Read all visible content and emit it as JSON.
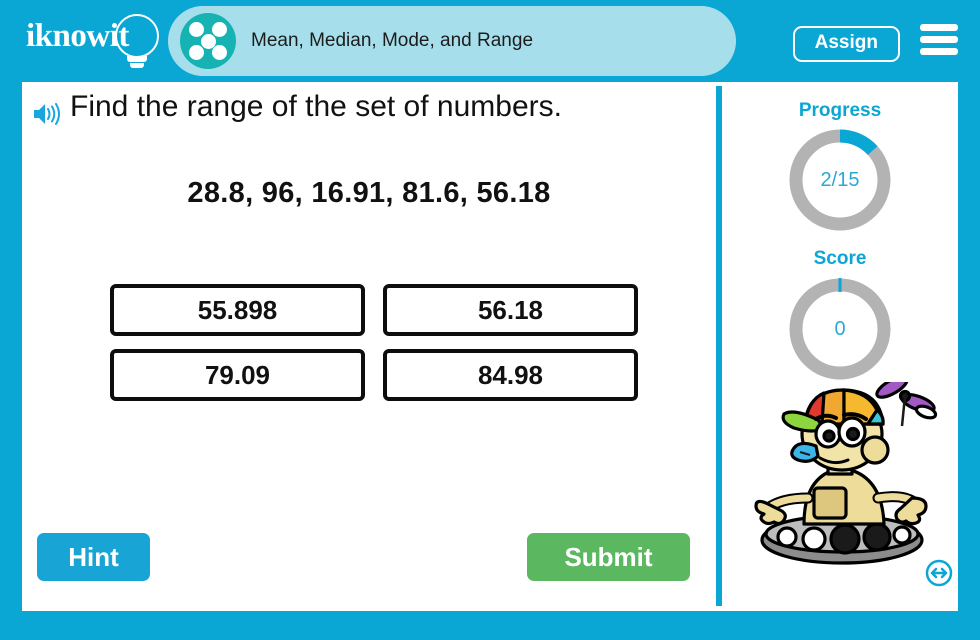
{
  "header": {
    "logo_text": "iknowit",
    "logo_icon": "lightbulb-icon",
    "topic_icon": "five-dots-icon",
    "title": "Mean, Median, Mode, and Range",
    "assign_label": "Assign",
    "menu_icon": "hamburger-menu-icon"
  },
  "question": {
    "speaker_icon": "speaker-audio-icon",
    "prompt": "Find the range of the set of numbers.",
    "numbers": "28.8, 96, 16.91, 81.6, 56.18"
  },
  "answers": [
    {
      "label": "55.898"
    },
    {
      "label": "56.18"
    },
    {
      "label": "79.09"
    },
    {
      "label": "84.98"
    }
  ],
  "actions": {
    "hint_label": "Hint",
    "submit_label": "Submit"
  },
  "sidebar": {
    "progress": {
      "label": "Progress",
      "value": "2/15",
      "current": 2,
      "total": 15,
      "percent": 13.3
    },
    "score": {
      "label": "Score",
      "value": "0",
      "percent": 0
    },
    "mascot_icon": "robot-mascot-icon",
    "resize_icon": "resize-horizontal-icon"
  },
  "colors": {
    "brand_blue": "#0aa6d4",
    "pill_blue": "#a6dfeb",
    "topic_teal": "#17b3b3",
    "submit_green": "#5cb860",
    "ring_gray": "#b3b3b3",
    "text_dark": "#111111"
  }
}
